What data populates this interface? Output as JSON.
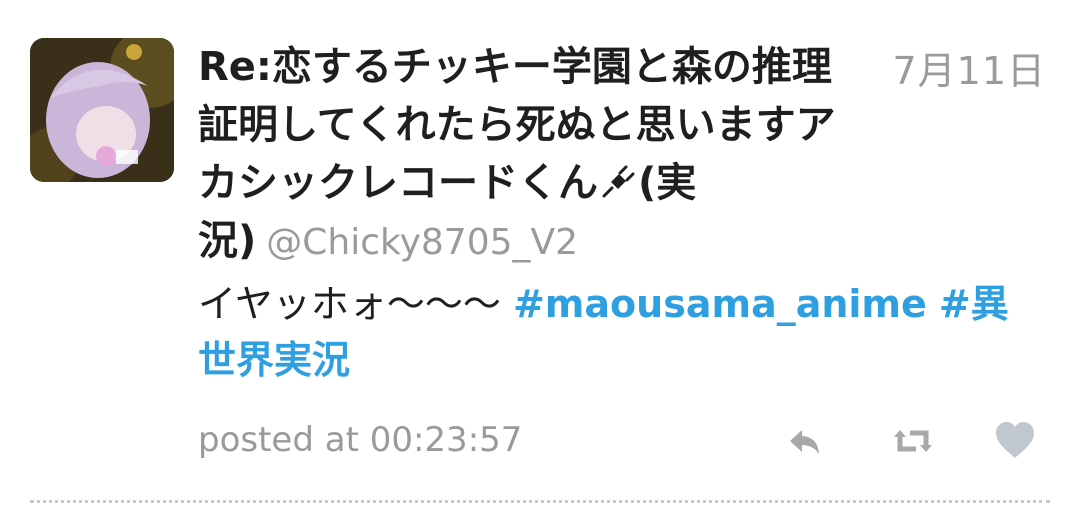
{
  "tweet": {
    "display_name_lines": [
      "Re:恋するチッキー学園と森の推理",
      "証明してくれたら死ぬと思いますア",
      "カシックレコードくん",
      "(実",
      "況)"
    ],
    "handle": "@Chicky8705_V2",
    "date": "7月11日",
    "body_text": "イヤッホォ〜〜〜",
    "hashtags": [
      "#maousama_anime",
      "#異",
      "世界実況"
    ],
    "posted_at": "posted at 00:23:57"
  },
  "actions": {
    "reply_icon": "reply-icon",
    "retweet_icon": "retweet-icon",
    "like_icon": "heart-icon"
  },
  "colors": {
    "hashtag": "#2e9fe0",
    "muted": "#9a9a9a",
    "text": "#1f1f1f"
  }
}
